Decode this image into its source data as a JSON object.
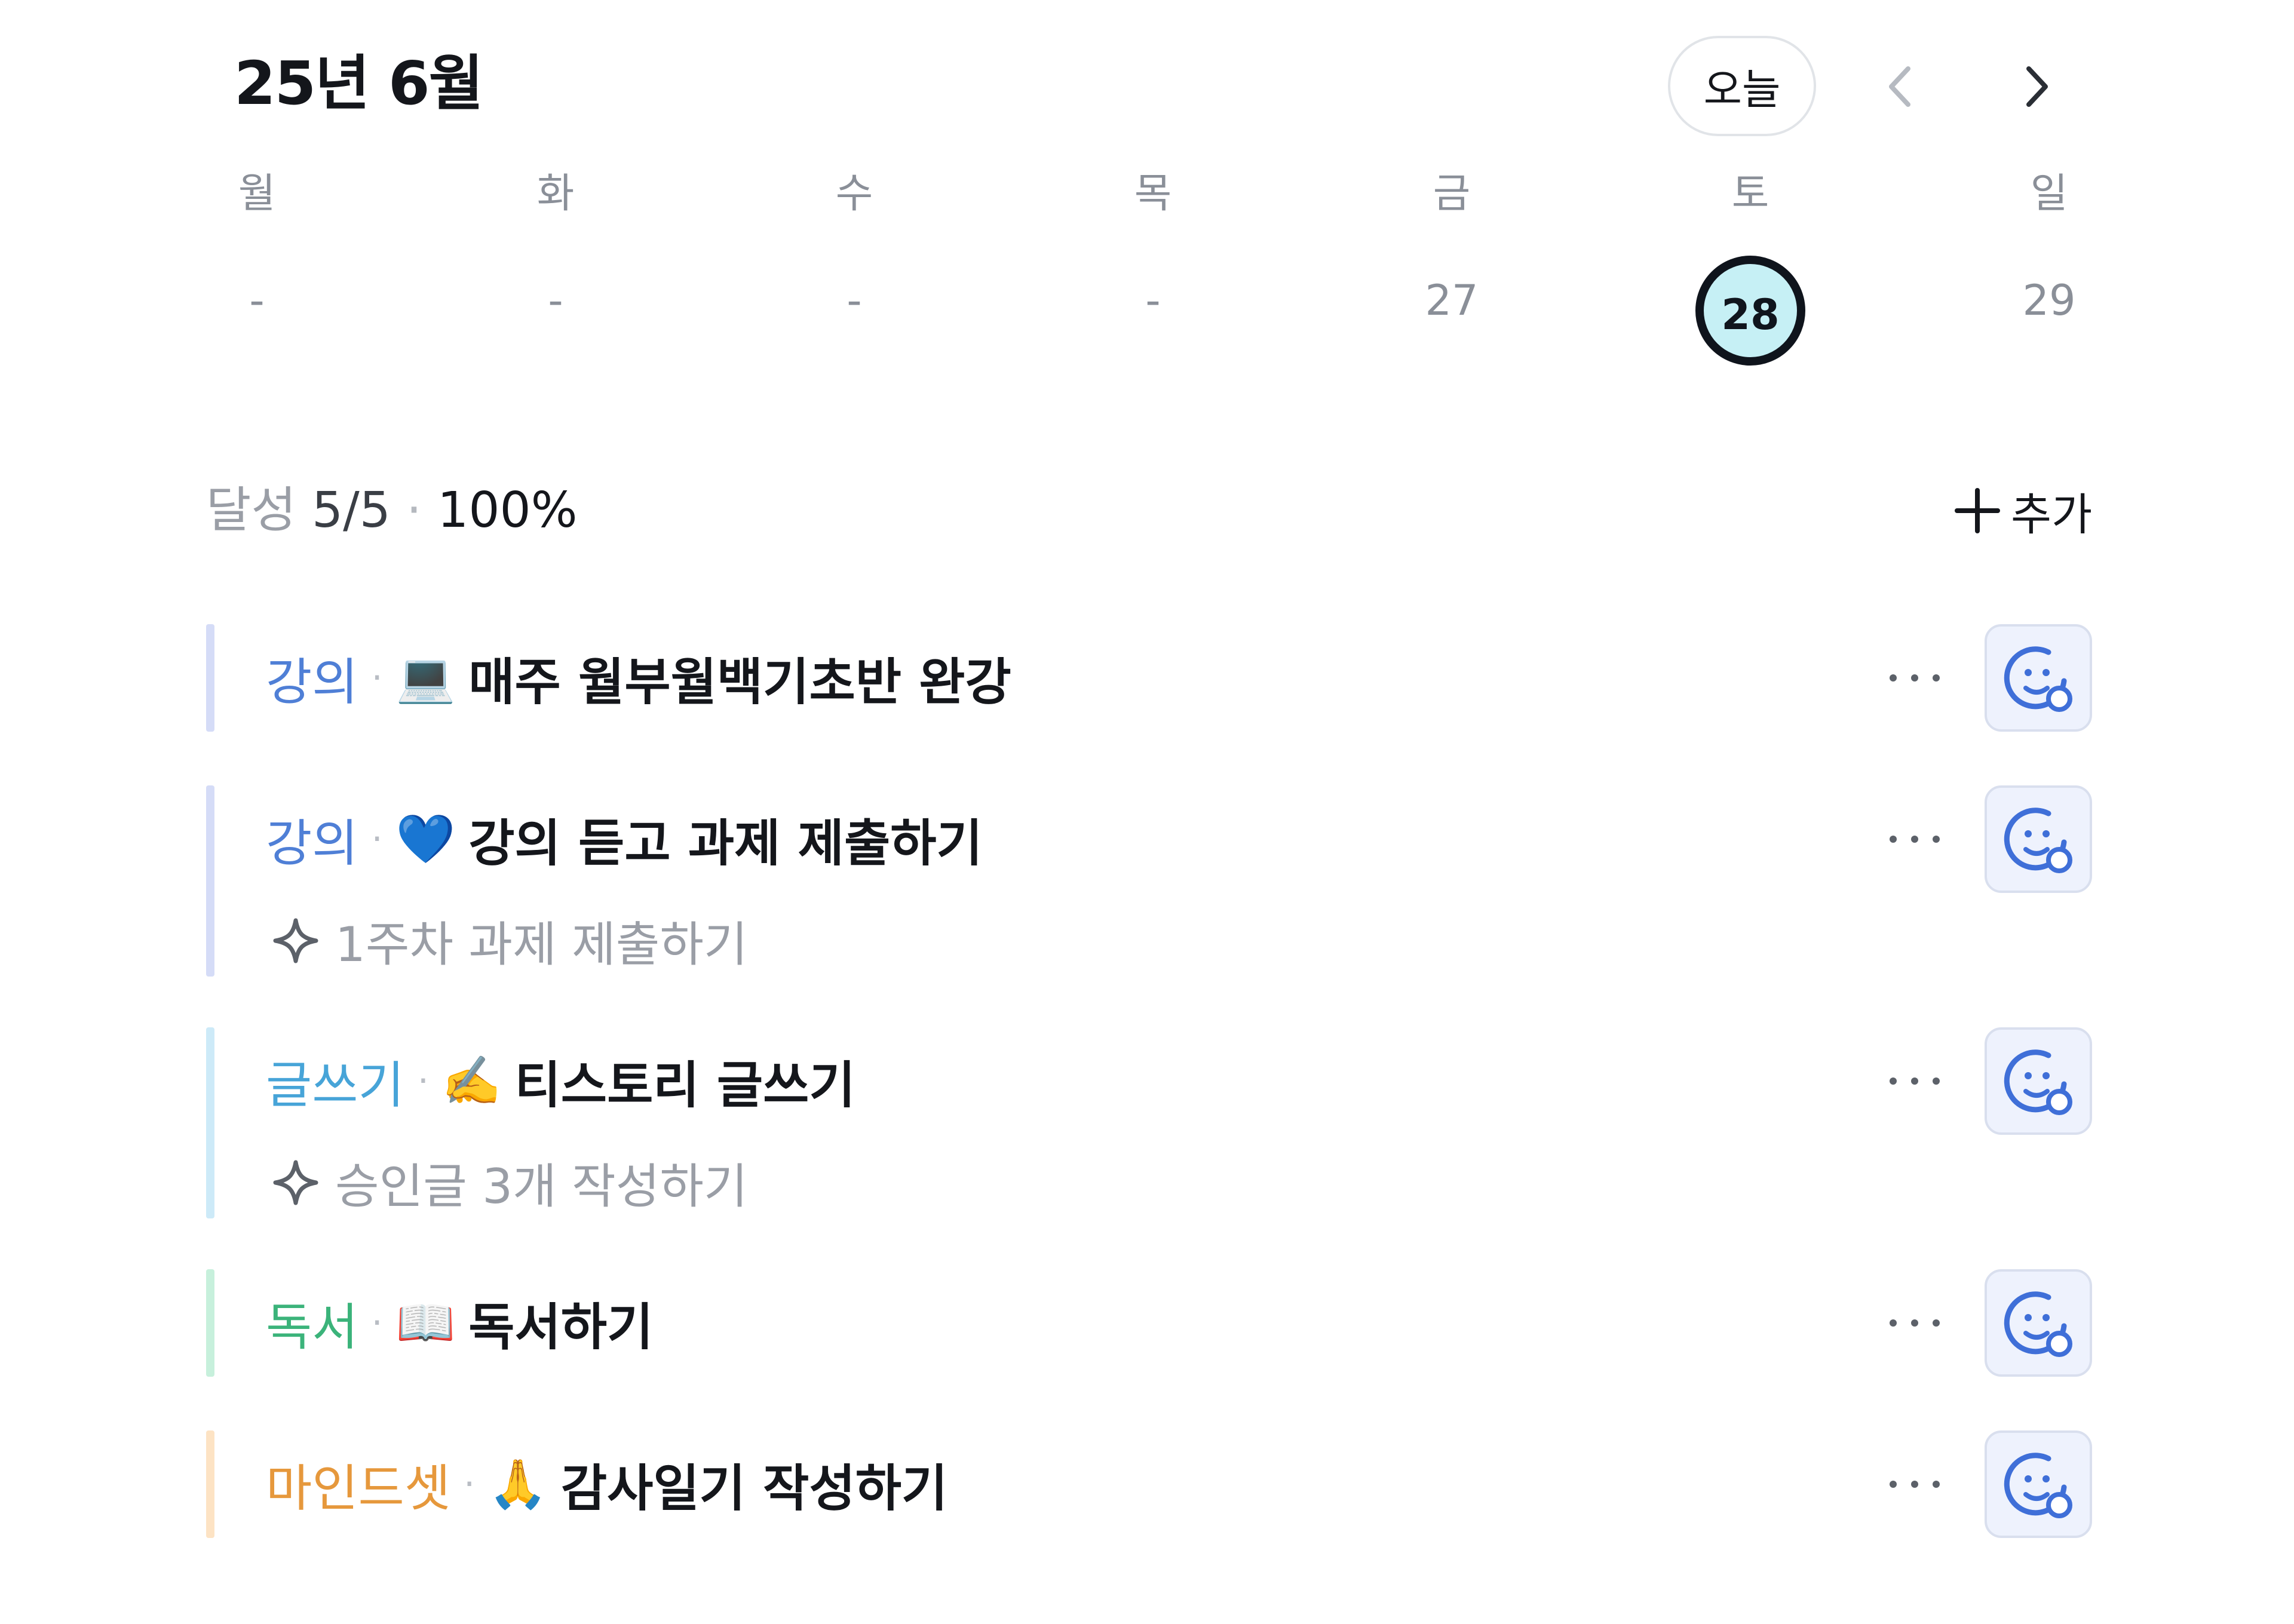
{
  "header": {
    "month_title": "25년 6월",
    "today_label": "오늘",
    "prev_icon": "chevron-left-icon",
    "next_icon": "chevron-right-icon"
  },
  "week": {
    "days": [
      {
        "label": "월",
        "num": "-"
      },
      {
        "label": "화",
        "num": "-"
      },
      {
        "label": "수",
        "num": "-"
      },
      {
        "label": "목",
        "num": "-"
      },
      {
        "label": "금",
        "num": "27"
      },
      {
        "label": "토",
        "num": "28"
      },
      {
        "label": "일",
        "num": "29"
      }
    ],
    "selected_index": 5,
    "selected_bg": "#c6f0f5",
    "selected_border": "#0f141c"
  },
  "summary": {
    "label": "달성",
    "count": "5/5",
    "separator": "·",
    "percent": "100%",
    "add_label": "추가",
    "add_icon": "plus-icon"
  },
  "tasks": [
    {
      "category": "강의",
      "category_color": "#4f7fd6",
      "bar_color": "#d5dcf7",
      "separator": "·",
      "emoji": "💻",
      "title": "매주 월부월백기초반 완강",
      "subtitle": ""
    },
    {
      "category": "강의",
      "category_color": "#4f7fd6",
      "bar_color": "#d5dcf7",
      "separator": "·",
      "emoji": "💙",
      "title": "강의 듣고 과제 제출하기",
      "subtitle": "1주차 과제 제출하기"
    },
    {
      "category": "글쓰기",
      "category_color": "#47a4d8",
      "bar_color": "#cdeaf8",
      "separator": "·",
      "emoji": "✍️",
      "title": "티스토리 글쓰기",
      "subtitle": "승인글 3개 작성하기"
    },
    {
      "category": "독서",
      "category_color": "#3bb37a",
      "bar_color": "#c7f0dc",
      "separator": "·",
      "emoji": "📖",
      "title": "독서하기",
      "subtitle": ""
    },
    {
      "category": "마인드셋",
      "category_color": "#e6983c",
      "bar_color": "#fde3c4",
      "separator": "·",
      "emoji": "🙏",
      "title": "감사일기 작성하기",
      "subtitle": ""
    }
  ],
  "icons": {
    "more": "more-dots-icon",
    "mood": "smiley-add-icon",
    "sparkle": "sparkle-icon",
    "mood_color": "#3f6fd8"
  }
}
